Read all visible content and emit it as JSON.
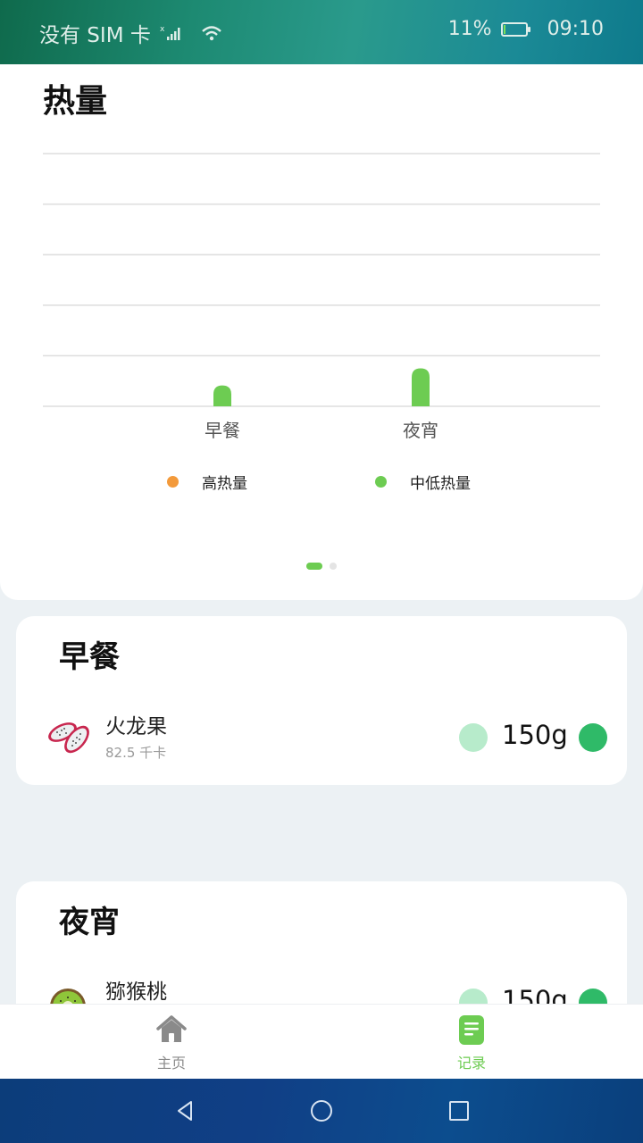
{
  "status_bar": {
    "carrier": "没有 SIM 卡",
    "battery_percent": "11%",
    "battery_level": 0.11,
    "time": "09:10"
  },
  "chart_card": {
    "title": "热量",
    "legend": [
      {
        "label": "高热量",
        "color": "#f39a3b"
      },
      {
        "label": "中低热量",
        "color": "#6dcc52"
      }
    ],
    "page_count": 2,
    "active_page": 0
  },
  "chart_data": {
    "type": "bar",
    "categories": [
      "早餐",
      "夜宵"
    ],
    "series": [
      {
        "name": "中低热量",
        "values": [
          82.5,
          150
        ],
        "color": "#6dcc52"
      },
      {
        "name": "高热量",
        "values": [
          0,
          0
        ],
        "color": "#f39a3b"
      }
    ],
    "ylim": [
      0,
      1000
    ],
    "grid": true,
    "legend_position": "bottom"
  },
  "breakfast": {
    "title": "早餐",
    "food": {
      "name": "火龙果",
      "kcal": "82.5 千卡",
      "quantity": "150g",
      "icon": "dragon-fruit-image"
    }
  },
  "night_snack": {
    "title": "夜宵",
    "food": {
      "name": "猕猴桃",
      "quantity": "150g",
      "icon": "kiwi-image"
    }
  },
  "tab_bar": {
    "tabs": [
      {
        "label": "主页",
        "icon": "home-icon",
        "active": false
      },
      {
        "label": "记录",
        "icon": "record-icon",
        "active": true
      }
    ],
    "active_color": "#6dcc52",
    "inactive_color": "#8a8a8a"
  },
  "nav_bar": {
    "buttons": [
      "back-icon",
      "home-circle-icon",
      "recents-icon"
    ]
  }
}
